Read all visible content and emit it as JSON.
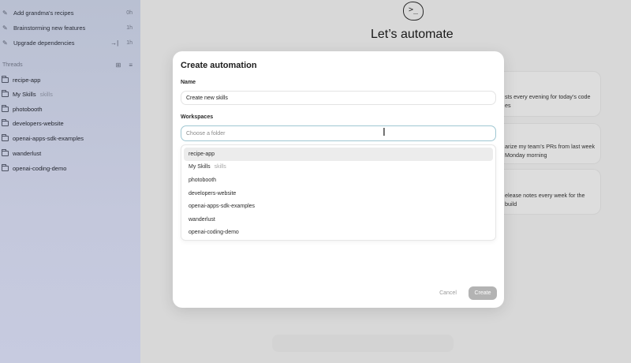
{
  "sidebar": {
    "pinned": [
      {
        "label": "Add grandma's recipes",
        "meta": "0h",
        "icon": "pin-icon"
      },
      {
        "label": "Brainstorming new features",
        "meta": "1h",
        "icon": "pin-icon"
      },
      {
        "label": "Upgrade dependencies",
        "meta": "1h",
        "icon": "pin-icon",
        "extra_icon": "arrow-to-right-icon",
        "extra_glyph": "→|"
      }
    ],
    "threads_label": "Threads",
    "threads_icons": {
      "new_folder": "⊞",
      "filter": "≡"
    },
    "threads": [
      {
        "label": "recipe-app",
        "tag": ""
      },
      {
        "label": "My Skills",
        "tag": "skills"
      },
      {
        "label": "photobooth",
        "tag": ""
      },
      {
        "label": "developers-website",
        "tag": ""
      },
      {
        "label": "openai-apps-sdk-examples",
        "tag": ""
      },
      {
        "label": "wanderlust",
        "tag": ""
      },
      {
        "label": "openai-coding-demo",
        "tag": ""
      }
    ]
  },
  "main": {
    "logo_glyph": ">_",
    "title": "Let’s automate",
    "bg_cards": [
      {
        "line1": "sts every evening for today’s code",
        "line2": "es"
      },
      {
        "line1": "arize my team’s PRs from last week",
        "line2": "Monday morning"
      },
      {
        "line1": "elease notes every week for the",
        "line2": "build"
      }
    ]
  },
  "modal": {
    "title": "Create automation",
    "name_label": "Name",
    "name_value": "Create new skills",
    "workspaces_label": "Workspaces",
    "folder_placeholder": "Choose a folder",
    "options": [
      {
        "label": "recipe-app",
        "tag": ""
      },
      {
        "label": "My Skills",
        "tag": "skills"
      },
      {
        "label": "photobooth",
        "tag": ""
      },
      {
        "label": "developers-website",
        "tag": ""
      },
      {
        "label": "openai-apps-sdk-examples",
        "tag": ""
      },
      {
        "label": "wanderlust",
        "tag": ""
      },
      {
        "label": "openai-coding-demo",
        "tag": ""
      }
    ],
    "cancel_label": "Cancel",
    "create_label": "Create"
  }
}
